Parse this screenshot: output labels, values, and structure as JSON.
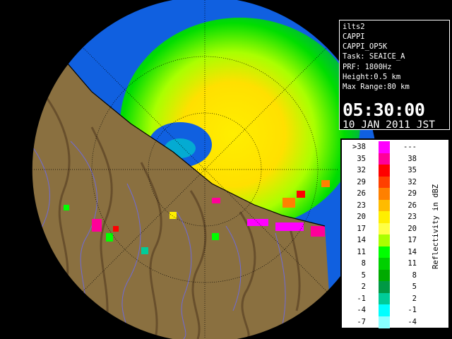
{
  "info": {
    "lines": [
      "ilts2",
      "CAPPI",
      "CAPPI_OP5K",
      "Task: SEAICE_A",
      "PRF: 1800Hz",
      "Height:0.5 km",
      "Max Range:80 km"
    ],
    "time": "05:30:00",
    "date": "10 JAN 2011 JST"
  },
  "legend": {
    "unit": "Reflectivity in dBZ",
    "rows": [
      {
        "lo": ">38",
        "hi": "---",
        "color": "#ff00ff"
      },
      {
        "lo": "35",
        "hi": "38",
        "color": "#ff0099"
      },
      {
        "lo": "32",
        "hi": "35",
        "color": "#ff0000"
      },
      {
        "lo": "29",
        "hi": "32",
        "color": "#ff4000"
      },
      {
        "lo": "26",
        "hi": "29",
        "color": "#ff8000"
      },
      {
        "lo": "23",
        "hi": "26",
        "color": "#ffbb00"
      },
      {
        "lo": "20",
        "hi": "23",
        "color": "#ffee00"
      },
      {
        "lo": "17",
        "hi": "20",
        "color": "#ffff44"
      },
      {
        "lo": "14",
        "hi": "17",
        "color": "#aaff00"
      },
      {
        "lo": "11",
        "hi": "14",
        "color": "#00ff00"
      },
      {
        "lo": "8",
        "hi": "11",
        "color": "#00d000"
      },
      {
        "lo": "5",
        "hi": "8",
        "color": "#00aa00"
      },
      {
        "lo": "2",
        "hi": "5",
        "color": "#009944"
      },
      {
        "lo": "-1",
        "hi": "2",
        "color": "#00cc99"
      },
      {
        "lo": "-4",
        "hi": "-1",
        "color": "#00ffff"
      },
      {
        "lo": "-7",
        "hi": "-4",
        "color": "#88ffff"
      }
    ]
  },
  "colors": {
    "sea_echo": "#1060e0",
    "terrain": "#8a7040",
    "background": "#000000"
  }
}
